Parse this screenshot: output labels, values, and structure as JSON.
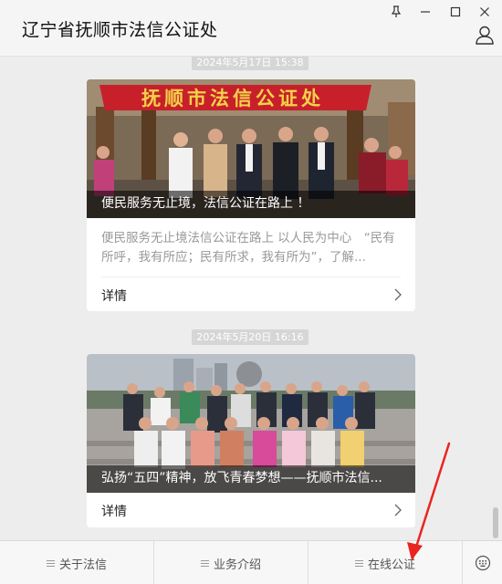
{
  "window": {
    "title": "辽宁省抚顺市法信公证处"
  },
  "feed": [
    {
      "timestamp": "2024年5月17日 15:38",
      "banner_text": "抚顺市法信公证处",
      "caption": "便民服务无止境，法信公证在路上 ！",
      "summary": "便民服务无止境法信公证在路上 以人民为中心　“民有所呼，我有所应；民有所求，我有所为”，了解...",
      "detail_label": "详情"
    },
    {
      "timestamp": "2024年5月20日 16:16",
      "caption": "弘扬“五四”精神，放飞青春梦想——抚顺市法信...",
      "detail_label": "详情"
    }
  ],
  "menu": {
    "items": [
      "关于法信",
      "业务介绍",
      "在线公证"
    ]
  },
  "colors": {
    "banner_red": "#c8202a",
    "banner_text": "#f3d24a",
    "arrow": "#e8251f"
  }
}
